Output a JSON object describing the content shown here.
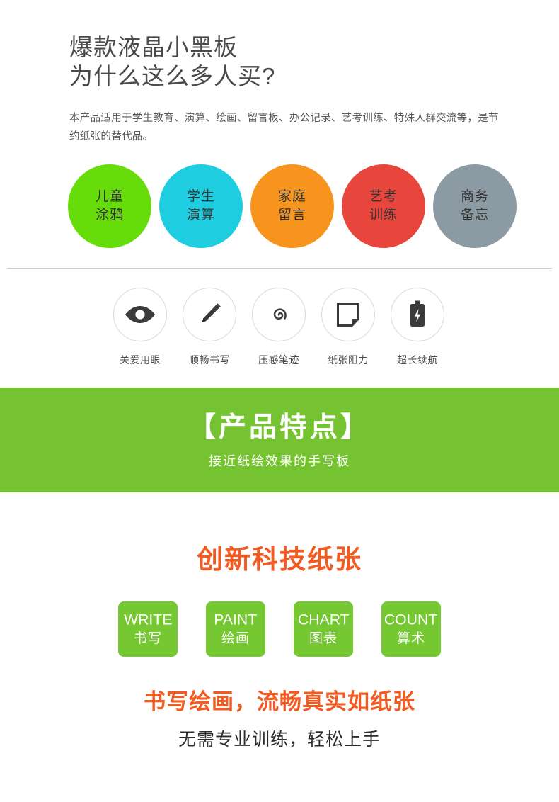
{
  "hero": {
    "title_line1": "爆款液晶小黑板",
    "title_line2": "为什么这么多人买?",
    "description": "本产品适用于学生教育、演算、绘画、留言板、办公记录、艺考训练、特殊人群交流等，是节约纸张的替代品。"
  },
  "use_cases": [
    {
      "line1": "儿童",
      "line2": "涂鸦",
      "color": "#66DD0A"
    },
    {
      "line1": "学生",
      "line2": "演算",
      "color": "#1ECDE0"
    },
    {
      "line1": "家庭",
      "line2": "留言",
      "color": "#F7941D"
    },
    {
      "line1": "艺考",
      "line2": "训练",
      "color": "#E8453C"
    },
    {
      "line1": "商务",
      "line2": "备忘",
      "color": "#8C9BA3"
    }
  ],
  "features": [
    {
      "label": "关爱用眼",
      "icon": "eye-icon"
    },
    {
      "label": "顺畅书写",
      "icon": "pen-icon"
    },
    {
      "label": "压感笔迹",
      "icon": "spiral-icon"
    },
    {
      "label": "纸张阻力",
      "icon": "paper-page-icon"
    },
    {
      "label": "超长续航",
      "icon": "battery-icon"
    }
  ],
  "banner": {
    "title": "【产品特点】",
    "subtitle": "接近纸绘效果的手写板",
    "background_color": "#76C332"
  },
  "innovation": {
    "title": "创新科技纸张",
    "title_color": "#F15A20",
    "tags": [
      {
        "en": "WRITE",
        "cn": "书写"
      },
      {
        "en": "PAINT",
        "cn": "绘画"
      },
      {
        "en": "CHART",
        "cn": "图表"
      },
      {
        "en": "COUNT",
        "cn": "算术"
      }
    ],
    "tag_color": "#76C832",
    "closing_line1": "书写绘画，流畅真实如纸张",
    "closing_line2": "无需专业训练，轻松上手"
  }
}
